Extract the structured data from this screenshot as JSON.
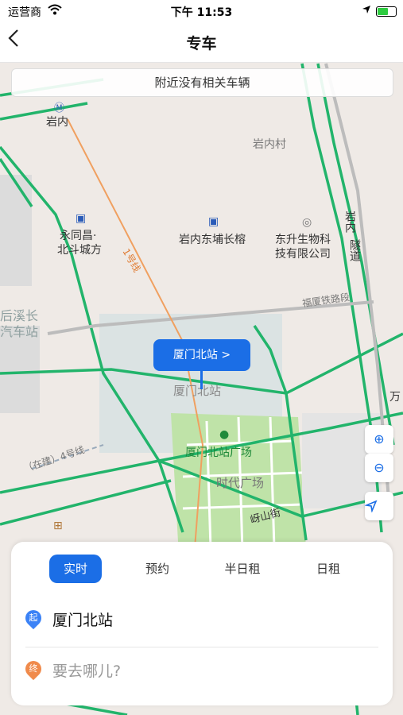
{
  "status_bar": {
    "carrier": "运营商",
    "time": "下午 11:53",
    "battery_level": 0.55
  },
  "nav": {
    "title": "专车",
    "back_icon": "chevron-left-icon"
  },
  "map": {
    "banner": "附近没有相关车辆",
    "labels": {
      "metro_station": "岩内",
      "village": "岩内村",
      "poi_yongtongchang_1": "永同昌·",
      "poi_yongtongchang_2": "北斗城方",
      "poi_yannei": "岩内东埔长榕",
      "poi_bio_1": "东升生物科",
      "poi_bio_2": "技有限公司",
      "tunnel_1": "岩内",
      "tunnel_2": "隧道",
      "line1": "1号线",
      "houxi_1": "后溪长",
      "houxi_2": "汽车站",
      "station_map": "厦门北站",
      "square": "厦门北站广场",
      "shidai": "时代广场",
      "line4": "（在建）4号线",
      "yanshan": "岈山街",
      "railway": "福厦铁路段",
      "wan": "万"
    },
    "callout": "厦门北站  >",
    "zoom_in_icon": "zoom-in-icon",
    "zoom_out_icon": "zoom-out-icon",
    "locate_icon": "locate-arrow-icon"
  },
  "panel": {
    "tabs": [
      "实时",
      "预约",
      "半日租",
      "日租"
    ],
    "active_tab": 0,
    "start": {
      "badge": "起",
      "value": "厦门北站"
    },
    "end": {
      "badge": "终",
      "placeholder": "要去哪儿?"
    },
    "colors": {
      "accent": "#1b6ee6",
      "start_pin": "#3b82f6",
      "end_pin": "#f08a4b"
    }
  }
}
